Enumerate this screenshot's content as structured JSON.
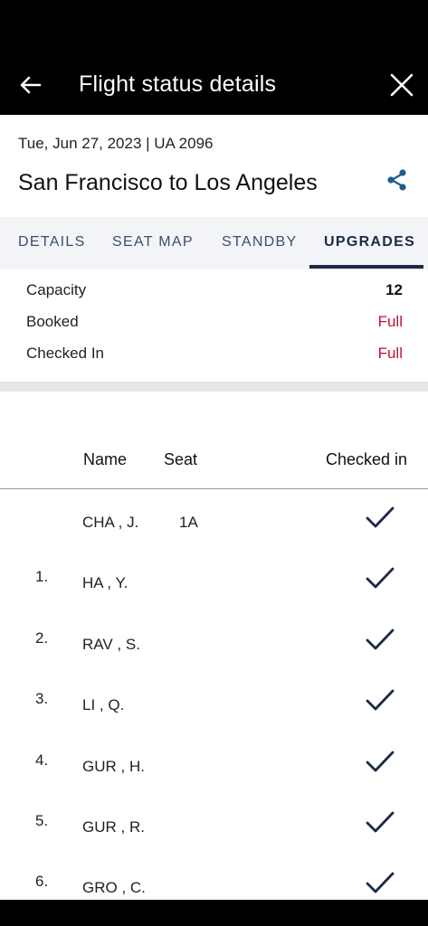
{
  "header": {
    "title": "Flight status details"
  },
  "flight": {
    "date_line": "Tue, Jun 27, 2023 | UA 2096",
    "route": "San Francisco to Los Angeles"
  },
  "tabs": [
    {
      "label": "DETAILS"
    },
    {
      "label": "SEAT MAP"
    },
    {
      "label": "STANDBY"
    },
    {
      "label": "UPGRADES"
    }
  ],
  "summary": {
    "capacity_label": "Capacity",
    "capacity_value": "12",
    "booked_label": "Booked",
    "booked_value": "Full",
    "checked_label": "Checked In",
    "checked_value": "Full"
  },
  "columns": {
    "name": "Name",
    "seat": "Seat",
    "checked": "Checked in"
  },
  "passengers": [
    {
      "idx": "",
      "name": "CHA , J.",
      "seat": "1A"
    },
    {
      "idx": "1.",
      "name": "HA , Y.",
      "seat": ""
    },
    {
      "idx": "2.",
      "name": "RAV , S.",
      "seat": ""
    },
    {
      "idx": "3.",
      "name": "LI , Q.",
      "seat": ""
    },
    {
      "idx": "4.",
      "name": "GUR , H.",
      "seat": ""
    },
    {
      "idx": "5.",
      "name": "GUR , R.",
      "seat": ""
    },
    {
      "idx": "6.",
      "name": "GRO , C.",
      "seat": ""
    }
  ],
  "colors": {
    "accent": "#1c2a44",
    "alert": "#c8102e",
    "tab_bg": "#f3f4f7"
  },
  "icons": {
    "back": "arrow-left-icon",
    "close": "close-icon",
    "share": "share-icon",
    "check": "checkmark-icon"
  }
}
